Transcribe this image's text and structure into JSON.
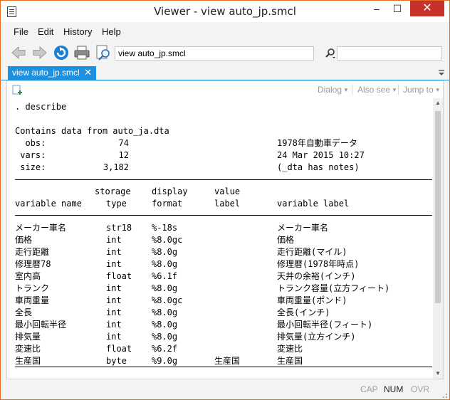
{
  "window": {
    "title": "Viewer - view auto_jp.smcl"
  },
  "menu": [
    "File",
    "Edit",
    "History",
    "Help"
  ],
  "toolbar": {
    "address": "view auto_jp.smcl",
    "search_value": ""
  },
  "tab": {
    "label": "view auto_jp.smcl",
    "close": "✕"
  },
  "viewer_menu": {
    "dialog": "Dialog",
    "also_see": "Also see",
    "jump_to": "Jump to"
  },
  "output": {
    "command": ". describe",
    "contains": "Contains data from auto_ja.dta",
    "obs_label": "  obs:",
    "obs_value": "74",
    "vars_label": " vars:",
    "vars_value": "12",
    "size_label": " size:",
    "size_value": "3,182",
    "data_label": "1978年自動車データ",
    "timestamp": "24 Mar 2015 10:27",
    "notes": "(_dta has notes)",
    "hdr1": {
      "storage": "storage",
      "display": "display",
      "value": "value"
    },
    "hdr2": {
      "name": "variable name",
      "type": "type",
      "format": "format",
      "label": "label",
      "varlabel": "variable label"
    },
    "rows": [
      {
        "name": "メーカー車名",
        "type": "str18",
        "format": "%-18s",
        "vlabel": "",
        "label": "メーカー車名"
      },
      {
        "name": "価格",
        "type": "int",
        "format": "%8.0gc",
        "vlabel": "",
        "label": "価格"
      },
      {
        "name": "走行距離",
        "type": "int",
        "format": "%8.0g",
        "vlabel": "",
        "label": "走行距離(マイル)"
      },
      {
        "name": "修理暦78",
        "type": "int",
        "format": "%8.0g",
        "vlabel": "",
        "label": "修理暦(1978年時点)"
      },
      {
        "name": "室内高",
        "type": "float",
        "format": "%6.1f",
        "vlabel": "",
        "label": "天井の余裕(インチ)"
      },
      {
        "name": "トランク",
        "type": "int",
        "format": "%8.0g",
        "vlabel": "",
        "label": "トランク容量(立方フィート)"
      },
      {
        "name": "車両重量",
        "type": "int",
        "format": "%8.0gc",
        "vlabel": "",
        "label": "車両重量(ポンド)"
      },
      {
        "name": "全長",
        "type": "int",
        "format": "%8.0g",
        "vlabel": "",
        "label": "全長(インチ)"
      },
      {
        "name": "最小回転半径",
        "type": "int",
        "format": "%8.0g",
        "vlabel": "",
        "label": "最小回転半径(フィート)"
      },
      {
        "name": "排気量",
        "type": "int",
        "format": "%8.0g",
        "vlabel": "",
        "label": "排気量(立方インチ)"
      },
      {
        "name": "変速比",
        "type": "float",
        "format": "%6.2f",
        "vlabel": "",
        "label": "変速比"
      },
      {
        "name": "生産国",
        "type": "byte",
        "format": "%9.0g",
        "vlabel": "生産国",
        "label": "生産国"
      }
    ]
  },
  "status": {
    "cap": "CAP",
    "num": "NUM",
    "ovr": "OVR"
  }
}
